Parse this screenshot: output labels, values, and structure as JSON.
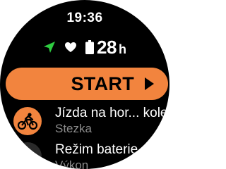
{
  "clock": {
    "time": "19:36"
  },
  "status": {
    "icons": [
      "navigation-arrow-icon",
      "heart-icon",
      "battery-icon"
    ],
    "nav_color": "#2ecc40",
    "battery_value": "28",
    "battery_unit": "h"
  },
  "start_button": {
    "label": "START",
    "color": "#f2843e",
    "icon": "play-arrow-icon"
  },
  "menu": {
    "items": [
      {
        "title": "Jízda na hor... kole",
        "subtitle": "Stezka",
        "icon": "mountain-bike-icon",
        "icon_bg": "#f2843e"
      },
      {
        "title": "Režim baterie",
        "subtitle": "Výkon",
        "icon": "battery-mode-icon",
        "icon_bg": "#2a2a2a"
      }
    ]
  }
}
